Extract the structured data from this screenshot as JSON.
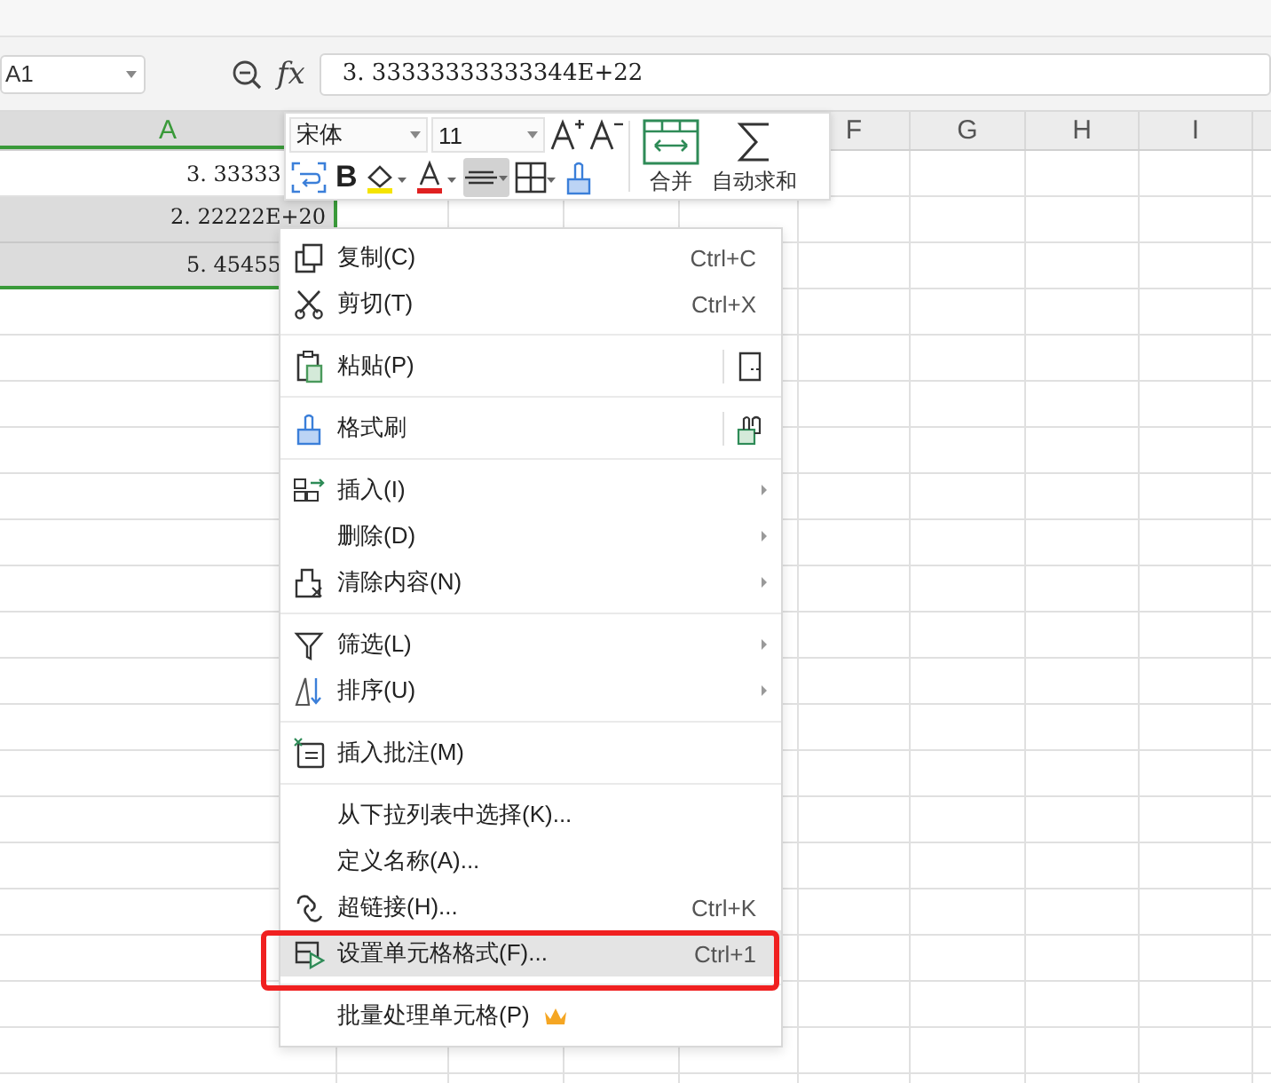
{
  "formula_bar": {
    "name_box": "A1",
    "fx": "fx",
    "value": "3. 33333333333344E+22"
  },
  "columns": [
    {
      "label": "A",
      "selected": true
    },
    {
      "label": "F",
      "selected": false
    },
    {
      "label": "G",
      "selected": false
    },
    {
      "label": "H",
      "selected": false
    },
    {
      "label": "I",
      "selected": false
    }
  ],
  "cells": [
    {
      "text": "3. 33333",
      "selected": false
    },
    {
      "text": "2. 22222E+20",
      "selected": true
    },
    {
      "text": "5. 45455",
      "selected": true
    }
  ],
  "mini_toolbar": {
    "font_name": "宋体",
    "font_size": "11",
    "bold": "B",
    "align_pressed": true,
    "merge": "合并",
    "autosum": "自动求和"
  },
  "context_menu": [
    [
      {
        "label": "复制(C)",
        "shortcut": "Ctrl+C",
        "submenu": false,
        "highlighted": false
      },
      {
        "label": "剪切(T)",
        "shortcut": "Ctrl+X",
        "submenu": false,
        "highlighted": false
      }
    ],
    [
      {
        "label": "粘贴(P)",
        "submenu": false,
        "highlighted": false
      }
    ],
    [
      {
        "label": "格式刷",
        "submenu": false,
        "highlighted": false
      }
    ],
    [
      {
        "label": "插入(I)",
        "submenu": true,
        "highlighted": false
      },
      {
        "label": "删除(D)",
        "submenu": true,
        "highlighted": false
      },
      {
        "label": "清除内容(N)",
        "submenu": true,
        "highlighted": false
      }
    ],
    [
      {
        "label": "筛选(L)",
        "submenu": true,
        "highlighted": false
      },
      {
        "label": "排序(U)",
        "submenu": true,
        "highlighted": false
      }
    ],
    [
      {
        "label": "插入批注(M)",
        "submenu": false,
        "highlighted": false
      }
    ],
    [
      {
        "label": "从下拉列表中选择(K)...",
        "submenu": false,
        "highlighted": false
      },
      {
        "label": "定义名称(A)...",
        "submenu": false,
        "highlighted": false
      },
      {
        "label": "超链接(H)...",
        "shortcut": "Ctrl+K",
        "submenu": false,
        "highlighted": false
      },
      {
        "label": "设置单元格格式(F)...",
        "shortcut": "Ctrl+1",
        "submenu": false,
        "highlighted": true
      }
    ],
    [
      {
        "label": "批量处理单元格(P)",
        "submenu": false,
        "highlighted": false
      }
    ]
  ]
}
